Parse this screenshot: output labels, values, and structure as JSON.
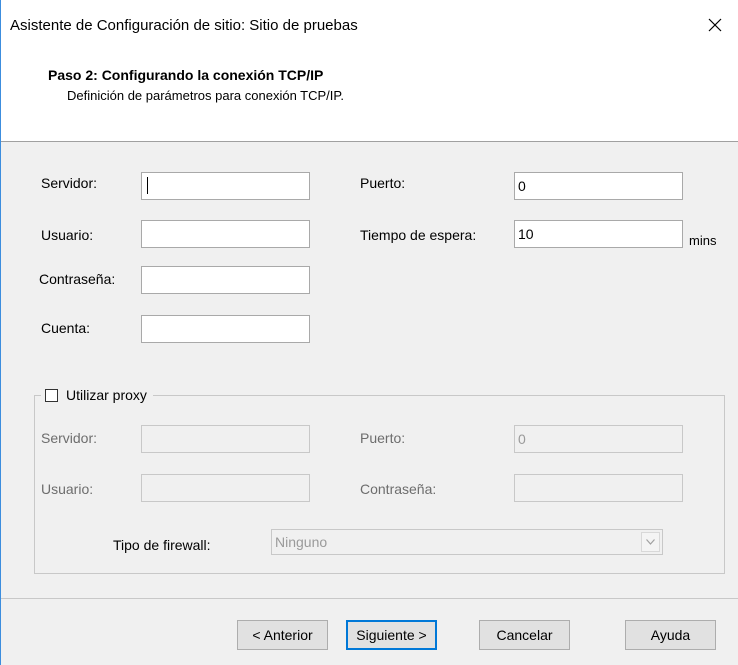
{
  "window": {
    "title": "Asistente de Configuración de sitio: Sitio de pruebas",
    "close_icon": "close-icon"
  },
  "header": {
    "step_title": "Paso 2: Configurando la conexión TCP/IP",
    "step_subtitle": "Definición de parámetros para conexión TCP/IP."
  },
  "connection": {
    "server_label": "Servidor:",
    "server_value": "",
    "user_label": "Usuario:",
    "user_value": "",
    "password_label": "Contraseña:",
    "password_value": "",
    "account_label": "Cuenta:",
    "account_value": "",
    "port_label": "Puerto:",
    "port_value": "0",
    "timeout_label": "Tiempo de espera:",
    "timeout_value": "10",
    "timeout_unit": "mins"
  },
  "proxy": {
    "checkbox_label": "Utilizar proxy",
    "checked": false,
    "server_label": "Servidor:",
    "server_value": "",
    "user_label": "Usuario:",
    "user_value": "",
    "port_label": "Puerto:",
    "port_value": "0",
    "password_label": "Contraseña:",
    "password_value": "",
    "firewall_label": "Tipo de firewall:",
    "firewall_value": "Ninguno"
  },
  "buttons": {
    "back": "< Anterior",
    "next": "Siguiente >",
    "cancel": "Cancelar",
    "help": "Ayuda"
  },
  "colors": {
    "window_border": "#3c8dde",
    "dialog_bg": "#f0f0f0",
    "default_button_border": "#0078d7"
  }
}
